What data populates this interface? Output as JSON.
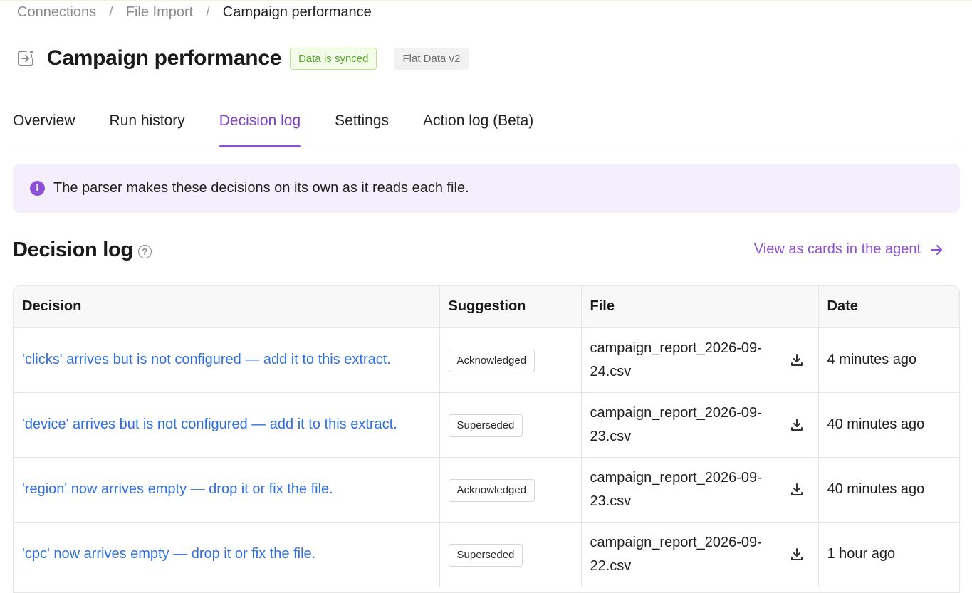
{
  "breadcrumb": {
    "items": [
      "Connections",
      "File Import",
      "Campaign performance"
    ],
    "separator": "/"
  },
  "header": {
    "icon": "file-import-icon",
    "title": "Campaign performance",
    "status_badge": "Data is synced",
    "version_badge": "Flat Data v2"
  },
  "tabs": [
    {
      "label": "Overview",
      "active": false
    },
    {
      "label": "Run history",
      "active": false
    },
    {
      "label": "Decision log",
      "active": true
    },
    {
      "label": "Settings",
      "active": false
    },
    {
      "label": "Action log (Beta)",
      "active": false
    }
  ],
  "notice": {
    "icon": "info-icon",
    "text": "The parser makes these decisions on its own as it reads each file."
  },
  "section": {
    "title": "Decision log",
    "help_icon": "help-icon",
    "view_link": "View as cards in the agent",
    "view_link_icon": "arrow-right-icon"
  },
  "table": {
    "columns": [
      "Decision",
      "Suggestion",
      "File",
      "Date"
    ],
    "rows": [
      {
        "decision": "'clicks' arrives but is not configured — add it to this extract.",
        "suggestion": "Acknowledged",
        "file": "campaign_report_2026-09-24.csv",
        "date": "4 minutes ago"
      },
      {
        "decision": "'device' arrives but is not configured — add it to this extract.",
        "suggestion": "Superseded",
        "file": "campaign_report_2026-09-23.csv",
        "date": "40 minutes ago"
      },
      {
        "decision": "'region' now arrives empty — drop it or fix the file.",
        "suggestion": "Acknowledged",
        "file": "campaign_report_2026-09-23.csv",
        "date": "40 minutes ago"
      },
      {
        "decision": "'cpc' now arrives empty — drop it or fix the file.",
        "suggestion": "Superseded",
        "file": "campaign_report_2026-09-22.csv",
        "date": "1 hour ago"
      }
    ]
  },
  "colors": {
    "accent": "#8d4fd8",
    "link": "#2f6fe0",
    "synced_green": "#5aa52c",
    "notice_bg": "#f5eefd"
  }
}
